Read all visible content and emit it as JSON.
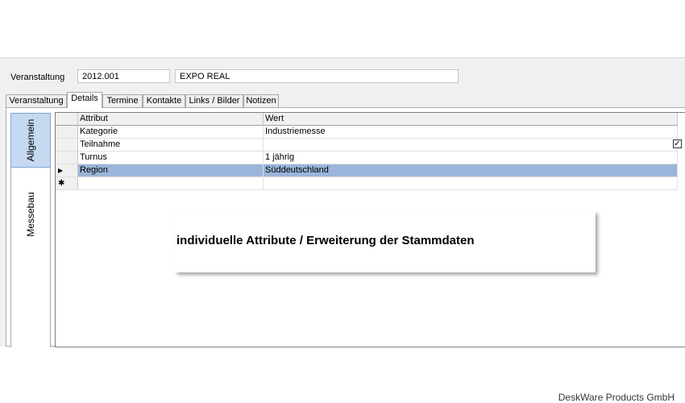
{
  "form": {
    "label": "Veranstaltung",
    "code": "2012.001",
    "name": "EXPO REAL"
  },
  "tabs": [
    {
      "label": "Veranstaltung"
    },
    {
      "label": "Details"
    },
    {
      "label": "Termine"
    },
    {
      "label": "Kontakte"
    },
    {
      "label": "Links / Bilder"
    },
    {
      "label": "Notizen"
    }
  ],
  "active_tab": "Details",
  "side_tabs": [
    {
      "label": "Allgemein"
    },
    {
      "label": "Messebau"
    }
  ],
  "grid": {
    "columns": [
      "Attribut",
      "Wert"
    ],
    "rows": [
      {
        "attribute": "Kategorie",
        "value": "Industriemesse"
      },
      {
        "attribute": "Teilnahme",
        "value": "",
        "checked": true
      },
      {
        "attribute": "Turnus",
        "value": "1 jährig"
      },
      {
        "attribute": "Region",
        "value": "Süddeutschland",
        "selected": true
      }
    ],
    "current_row_marker": "▶",
    "new_row_marker": "✱",
    "check_glyph": "✓"
  },
  "callout": {
    "text": "individuelle Attribute / Erweiterung der Stammdaten"
  },
  "footer": {
    "text": "DeskWare Products GmbH"
  },
  "colors": {
    "selection": "#9ab5d9",
    "side_tab_active": "#c5d9f1"
  }
}
